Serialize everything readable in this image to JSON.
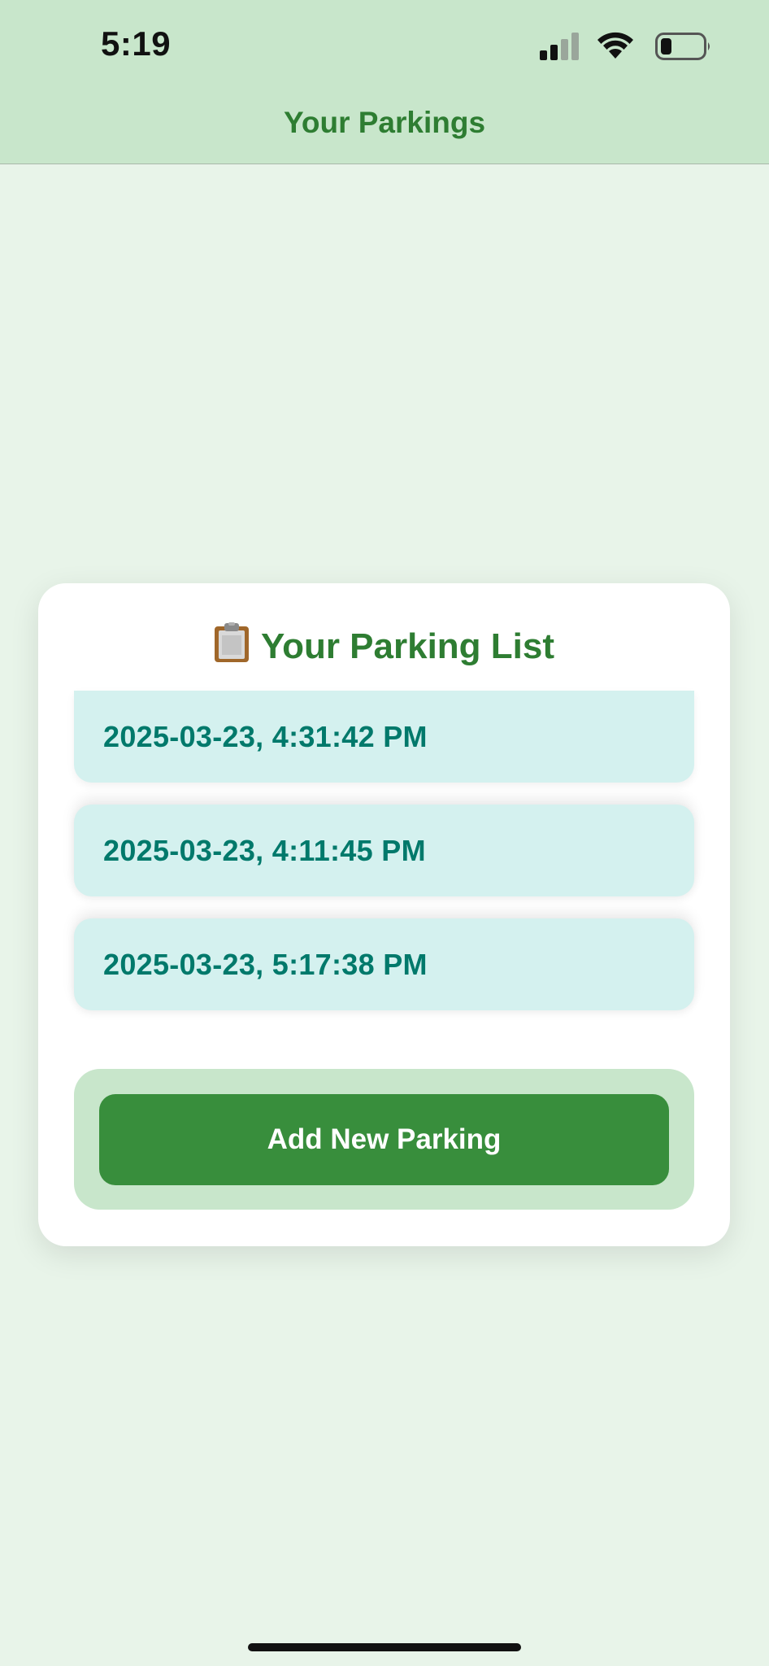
{
  "status_bar": {
    "time": "5:19",
    "icons": [
      "cellular-signal-icon",
      "wifi-icon",
      "battery-icon"
    ]
  },
  "header": {
    "title": "Your Parkings"
  },
  "card": {
    "icon": "clipboard-icon",
    "title": "Your Parking List",
    "items": [
      {
        "label": "2025-03-23, 4:31:42 PM"
      },
      {
        "label": "2025-03-23, 4:11:45 PM"
      },
      {
        "label": "2025-03-23, 5:17:38 PM"
      }
    ],
    "add_button_label": "Add New Parking"
  },
  "colors": {
    "background": "#e8f4e9",
    "header_background": "#c8e6cb",
    "title_green": "#2e7d32",
    "item_background": "#d4f1ef",
    "item_text": "#00796b",
    "button_green": "#388e3c"
  }
}
